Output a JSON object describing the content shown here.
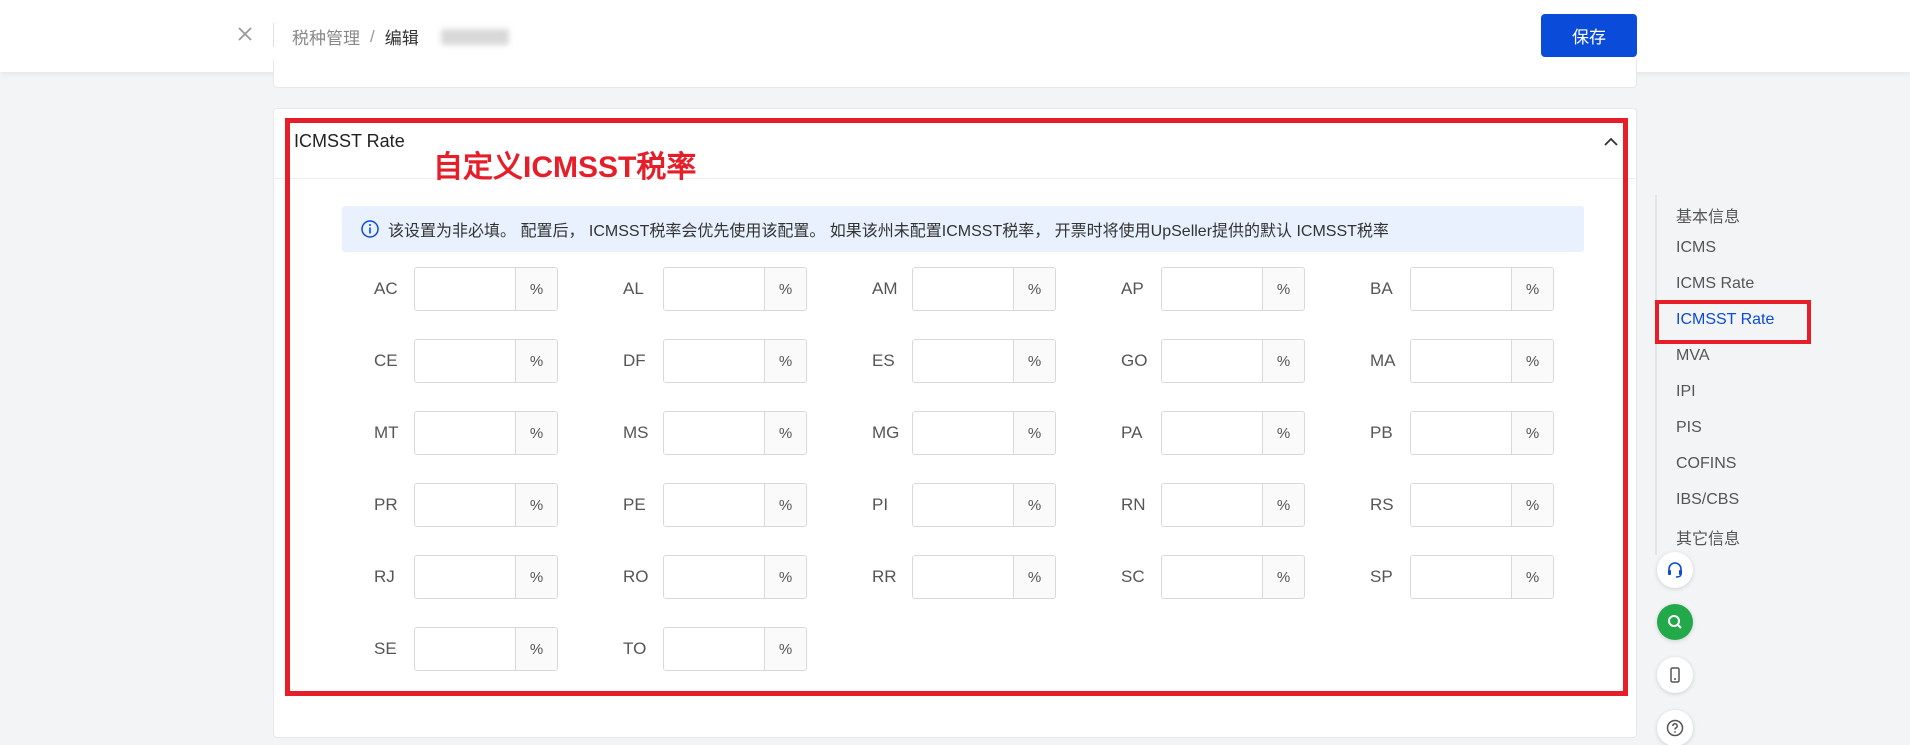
{
  "header": {
    "breadcrumb_root": "税种管理",
    "breadcrumb_sep": "/",
    "breadcrumb_current": "编辑",
    "save_label": "保存"
  },
  "section": {
    "title": "ICMSST Rate",
    "annotation": "自定义ICMSST税率",
    "notice": "该设置为非必填。 配置后， ICMSST税率会优先使用该配置。 如果该州未配置ICMSST税率， 开票时将使用UpSeller提供的默认 ICMSST税率"
  },
  "rates": {
    "unit": "%",
    "states": [
      "AC",
      "AL",
      "AM",
      "AP",
      "BA",
      "CE",
      "DF",
      "ES",
      "GO",
      "MA",
      "MT",
      "MS",
      "MG",
      "PA",
      "PB",
      "PR",
      "PE",
      "PI",
      "RN",
      "RS",
      "RJ",
      "RO",
      "RR",
      "SC",
      "SP",
      "SE",
      "TO"
    ]
  },
  "side_nav": {
    "items": [
      "基本信息",
      "ICMS",
      "ICMS Rate",
      "ICMSST Rate",
      "MVA",
      "IPI",
      "PIS",
      "COFINS",
      "IBS/CBS",
      "其它信息"
    ],
    "active": "ICMSST Rate"
  },
  "colors": {
    "primary": "#0a4bd9",
    "annotation_red": "#e61e2a",
    "notice_bg": "#e8f1fd",
    "search_green": "#22a94a"
  }
}
